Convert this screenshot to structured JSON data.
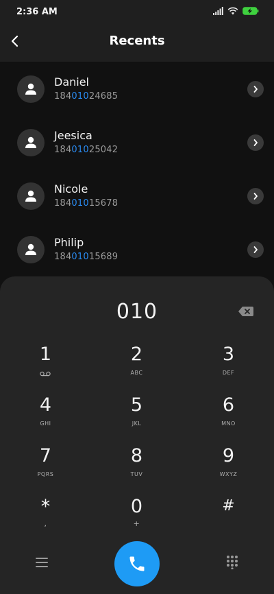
{
  "status_bar": {
    "time": "2:36 AM",
    "icons": [
      "signal-icon",
      "wifi-icon",
      "battery-charging-icon"
    ]
  },
  "header": {
    "title": "Recents",
    "back_icon": "chevron-left-icon"
  },
  "recents": [
    {
      "name": "Daniel",
      "number_prefix": "184",
      "number_match": "010",
      "number_suffix": "24685"
    },
    {
      "name": "Jeesica",
      "number_prefix": "184",
      "number_match": "010",
      "number_suffix": "25042"
    },
    {
      "name": "Nicole",
      "number_prefix": "184",
      "number_match": "010",
      "number_suffix": "15678"
    },
    {
      "name": "Philip",
      "number_prefix": "184",
      "number_match": "010",
      "number_suffix": "15689"
    }
  ],
  "dialer": {
    "dialed_number": "010",
    "keys": [
      {
        "digit": "1",
        "letters": "",
        "sub_icon": "voicemail-icon"
      },
      {
        "digit": "2",
        "letters": "ABC"
      },
      {
        "digit": "3",
        "letters": "DEF"
      },
      {
        "digit": "4",
        "letters": "GHI"
      },
      {
        "digit": "5",
        "letters": "JKL"
      },
      {
        "digit": "6",
        "letters": "MNO"
      },
      {
        "digit": "7",
        "letters": "PQRS"
      },
      {
        "digit": "8",
        "letters": "TUV"
      },
      {
        "digit": "9",
        "letters": "WXYZ"
      },
      {
        "digit": "*",
        "letters": ","
      },
      {
        "digit": "0",
        "letters": "+"
      },
      {
        "digit": "#",
        "letters": ""
      }
    ]
  },
  "bottom_bar": {
    "menu_icon": "menu-icon",
    "call_icon": "phone-icon",
    "keypad_icon": "dialpad-icon"
  },
  "colors": {
    "accent": "#1e9bf5",
    "match_highlight": "#2a8bf2",
    "background": "#111111",
    "panel": "#252525"
  }
}
